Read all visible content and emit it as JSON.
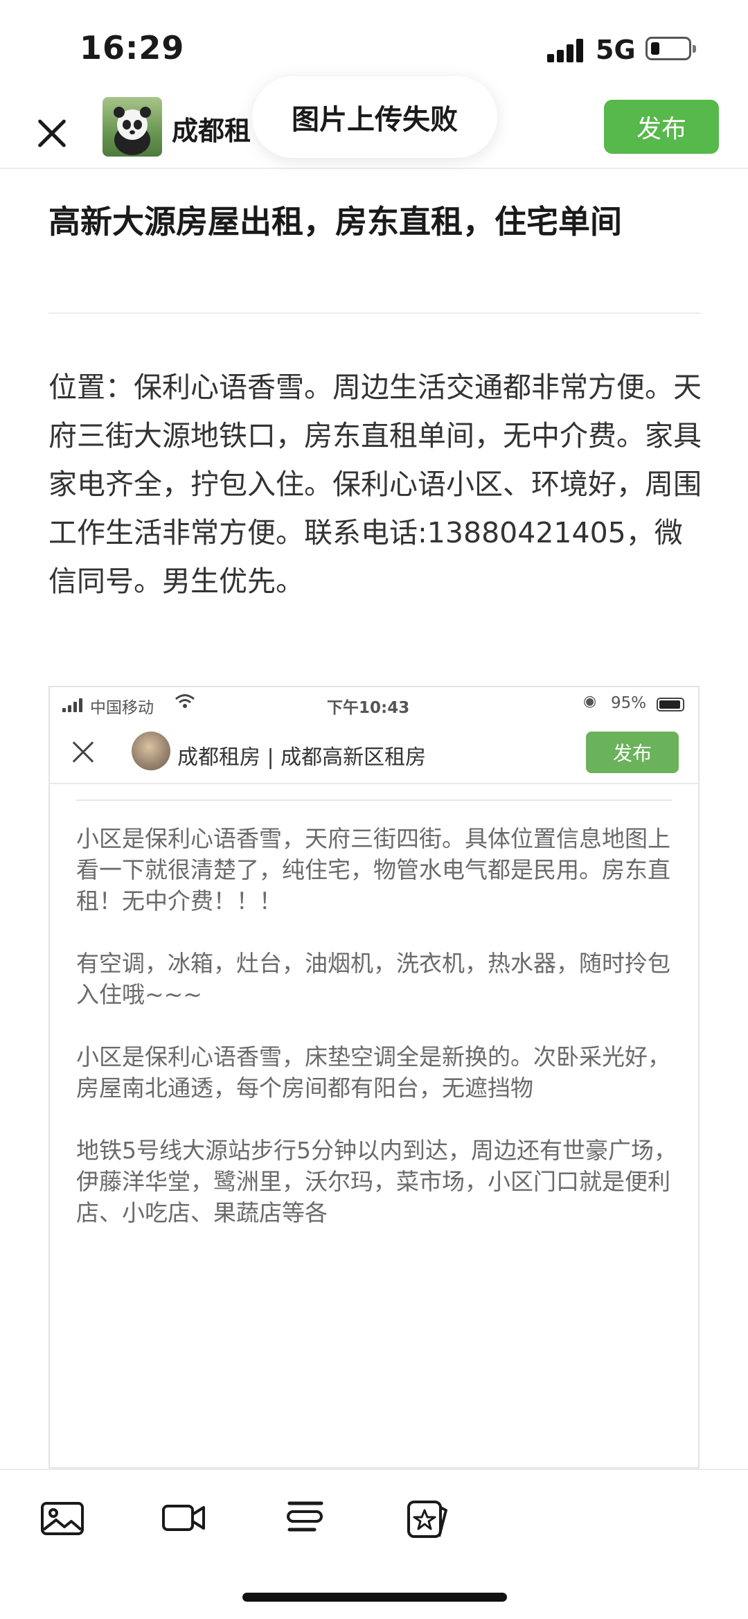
{
  "status_bar": {
    "time": "16:29",
    "network": "5G"
  },
  "header": {
    "group_name": "成都租",
    "toast": "图片上传失败",
    "publish_label": "发布"
  },
  "post": {
    "title": "高新大源房屋出租，房东直租，住宅单间",
    "body": "位置：保利心语香雪。周边生活交通都非常方便。天府三街大源地铁口，房东直租单间，无中介费。家具家电齐全，拧包入住。保利心语小区、环境好，周围工作生活非常方便。联系电话:13880421405，微信同号。男生优先。"
  },
  "embedded": {
    "carrier": "中国移动",
    "time": "下午10:43",
    "battery": "95%",
    "title": "成都租房 | 成都高新区租房",
    "publish_label": "发布",
    "paragraphs": [
      "小区是保利心语香雪，天府三街四街。具体位置信息地图上看一下就很清楚了，纯住宅，物管水电气都是民用。房东直租！无中介费！！！",
      "有空调，冰箱，灶台，油烟机，洗衣机，热水器，随时拎包入住哦~~~",
      "小区是保利心语香雪，床垫空调全是新换的。次卧采光好，房屋南北通透，每个房间都有阳台，无遮挡物",
      "地铁5号线大源站步行5分钟以内到达，周边还有世豪广场，伊藤洋华堂，鹭洲里，沃尔玛，菜市场，小区门口就是便利店、小吃店、果蔬店等各"
    ]
  },
  "toolbar": {
    "icons": [
      "image-icon",
      "video-icon",
      "text-format-icon",
      "sticker-icon"
    ]
  },
  "colors": {
    "accent": "#57b84b",
    "text": "#1a1a1a",
    "body_text": "#333333"
  }
}
